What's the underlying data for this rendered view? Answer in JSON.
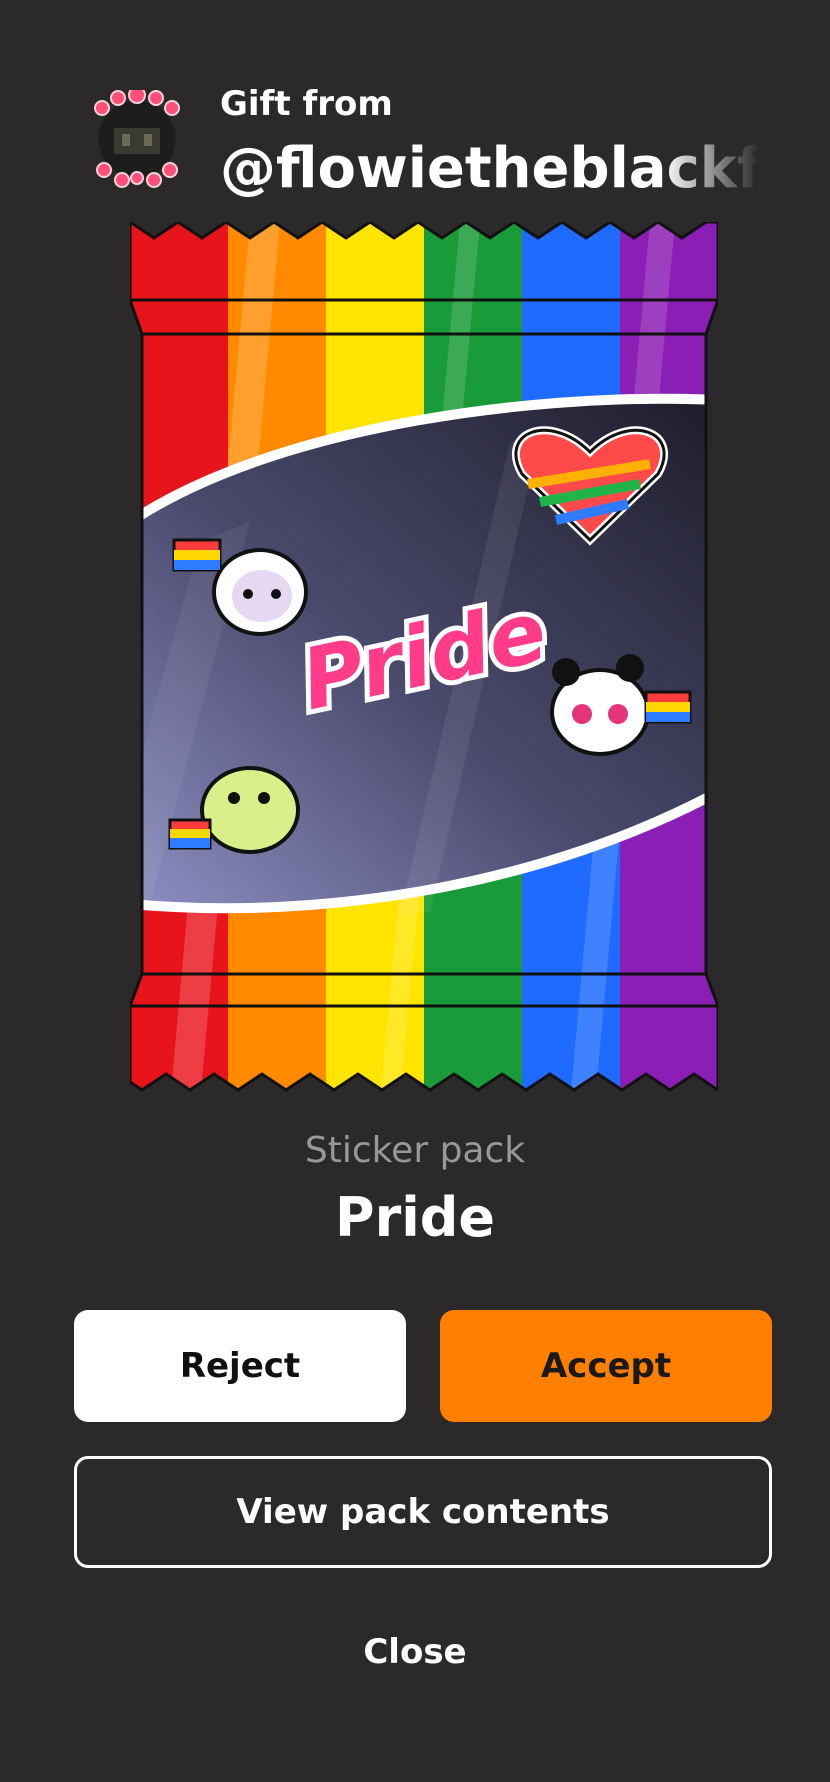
{
  "header": {
    "gift_label": "Gift from",
    "username": "@flowietheblackflo"
  },
  "pack": {
    "artwork_text": "Pride",
    "stripe_colors": [
      "#e8141c",
      "#ff8a00",
      "#ffe400",
      "#1a9b3a",
      "#1f6bff",
      "#8b1fb5"
    ]
  },
  "info": {
    "type_label": "Sticker pack",
    "name": "Pride"
  },
  "buttons": {
    "reject": "Reject",
    "accept": "Accept",
    "view_contents": "View pack contents",
    "close": "Close"
  },
  "colors": {
    "background": "#2c292b",
    "accent": "#ff7f00"
  },
  "icons": {
    "avatar": "user-avatar-with-hearts"
  }
}
